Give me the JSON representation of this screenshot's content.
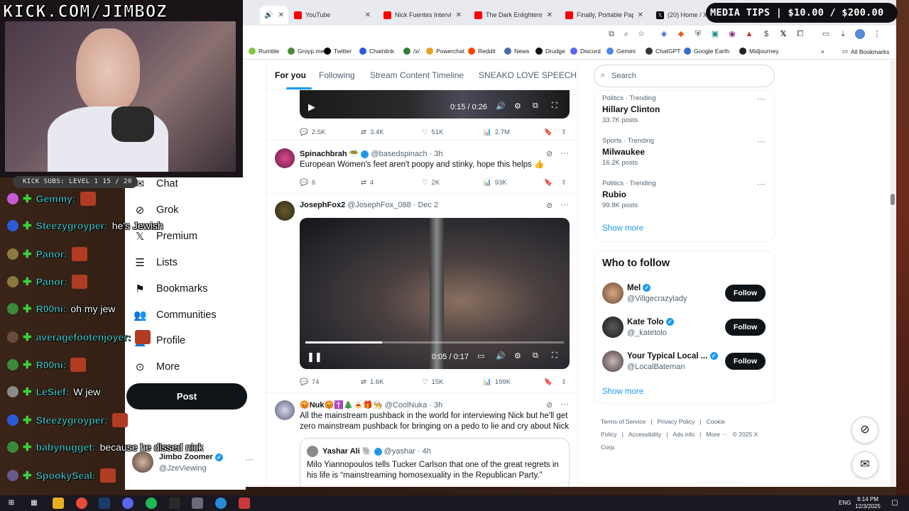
{
  "overlay": {
    "stream_url": "KICK.COM/JIMBOZ",
    "media_tips": "MEDIA TIPS | $10.00 / $200.00",
    "kick_subs": "KICK SUBS: LEVEL 1 15 / 20"
  },
  "browser": {
    "tabs": [
      {
        "label": "",
        "favicon": "#ff0033",
        "active": true
      },
      {
        "label": "YouTube",
        "favicon": "#ff0000"
      },
      {
        "label": "Nick Fuentes Interview",
        "favicon": "#ff0000"
      },
      {
        "label": "The Dark Enlightenment",
        "favicon": "#ff0000"
      },
      {
        "label": "Finally, Portable Paper",
        "favicon": "#ff0000"
      },
      {
        "label": "(20) Home / X",
        "favicon": "#000000"
      }
    ],
    "bookmarks": [
      {
        "label": "Rumble",
        "color": "#85c742"
      },
      {
        "label": "Groyp.me",
        "color": "#4a8a3a"
      },
      {
        "label": "Twitter",
        "color": "#000000"
      },
      {
        "label": "Chainlink",
        "color": "#2a5ada"
      },
      {
        "label": "/x/",
        "color": "#3a7a3a"
      },
      {
        "label": "Powerchat",
        "color": "#e8a020"
      },
      {
        "label": "Reddit",
        "color": "#ff4500"
      },
      {
        "label": "News",
        "color": "#4a6ab0"
      },
      {
        "label": "Drudge",
        "color": "#111111"
      },
      {
        "label": "Discord",
        "color": "#5865f2"
      },
      {
        "label": "Gemini",
        "color": "#4a8ae8"
      },
      {
        "label": "ChatGPT",
        "color": "#333333"
      },
      {
        "label": "Google Earth",
        "color": "#3a6ad8"
      },
      {
        "label": "Midjourney",
        "color": "#222222"
      }
    ],
    "all_bookmarks": "All Bookmarks"
  },
  "feed": {
    "tabs": [
      "For you",
      "Following",
      "Stream Content Timeline",
      "SNEAKO LOVE SPEECH"
    ],
    "video1": {
      "time": "0:15 / 0:26"
    },
    "tweet0_actions": {
      "replies": "2.5K",
      "reposts": "3.4K",
      "likes": "51K",
      "views": "2.7M"
    },
    "tweet1": {
      "name": "Spinachbrah 🥗",
      "handle": "@basedspinach · 3h",
      "text": "European Women's feet aren't poopy and stinky, hope this helps 👍",
      "replies": "6",
      "reposts": "4",
      "likes": "2K",
      "views": "93K"
    },
    "tweet2": {
      "name": "JosephFox2",
      "handle": "@JosephFox_088 · Dec 2",
      "time": "0:05 / 0:17",
      "replies": "74",
      "reposts": "1.6K",
      "likes": "15K",
      "views": "199K"
    },
    "tweet3": {
      "name": "😡Nuk😡✝️🎄🍝🎁👨‍🍳",
      "handle": "@CoolNuka · 3h",
      "text": "All the mainstream pushback in the world for interviewing Nick but he'll get zero mainstream pushback for bringing on a pedo to lie and cry about Nick",
      "quote_name": "Yashar Ali 🐘",
      "quote_handle": "@yashar · 4h",
      "quote_text": "Milo Yiannopoulos tells Tucker Carlson that one of the great regrets in his life is “mainstreaming homosexuality in the Republican Party.”"
    }
  },
  "right": {
    "search_placeholder": "Search",
    "trends": [
      {
        "category": "Politics · Trending",
        "title": "Hillary Clinton",
        "count": "33.7K posts"
      },
      {
        "category": "Sports · Trending",
        "title": "Milwaukee",
        "count": "16.2K posts"
      },
      {
        "category": "Politics · Trending",
        "title": "Rubio",
        "count": "99.8K posts"
      }
    ],
    "show_more": "Show more",
    "who_to_follow": "Who to follow",
    "follows": [
      {
        "name": "Mel",
        "handle": "@Villgecrazylady"
      },
      {
        "name": "Kate Tolo",
        "handle": "@_katetolo"
      },
      {
        "name": "Your Typical Local ...",
        "handle": "@LocalBateman"
      }
    ],
    "follow_label": "Follow",
    "footer": [
      "Terms of Service",
      "|",
      "Privacy Policy",
      "|",
      "Cookie Policy",
      "|",
      "Accessibility",
      "|",
      "Ads info",
      "|",
      "More ···",
      "© 2025 X Corp."
    ]
  },
  "nav": {
    "items": [
      "Chat",
      "Grok",
      "Premium",
      "Lists",
      "Bookmarks",
      "Communities",
      "Profile",
      "More"
    ],
    "post": "Post",
    "profile_name": "Jimbo Zoomer",
    "profile_handle": "@JzeViewing"
  },
  "chat": [
    {
      "user": "Gemmy:",
      "msg": "",
      "color": "#c85ad8"
    },
    {
      "user": "Steezygroyper:",
      "msg": "he's Jewish",
      "color": "#2a5ad8"
    },
    {
      "user": "Panor:",
      "msg": "",
      "color": "#8a7a40"
    },
    {
      "user": "Panor:",
      "msg": "",
      "color": "#8a7a40"
    },
    {
      "user": "R00ni:",
      "msg": "oh my jew",
      "color": "#3a8a3a"
    },
    {
      "user": "averagefootenjoyer:",
      "msg": "",
      "color": "#6a4a3a"
    },
    {
      "user": "R00ni:",
      "msg": "",
      "color": "#3a8a3a"
    },
    {
      "user": "LeSief:",
      "msg": "W jew",
      "color": "#8a8a8a"
    },
    {
      "user": "Steezygroyper:",
      "msg": "",
      "color": "#2a5ad8"
    },
    {
      "user": "babynugget:",
      "msg": "because he dissed nick",
      "color": "#3a8a3a"
    },
    {
      "user": "SpookySeal:",
      "msg": "",
      "color": "#6a5a8a"
    }
  ],
  "taskbar": {
    "lang": "ENG",
    "time": "6:14 PM",
    "date": "12/3/2025"
  }
}
